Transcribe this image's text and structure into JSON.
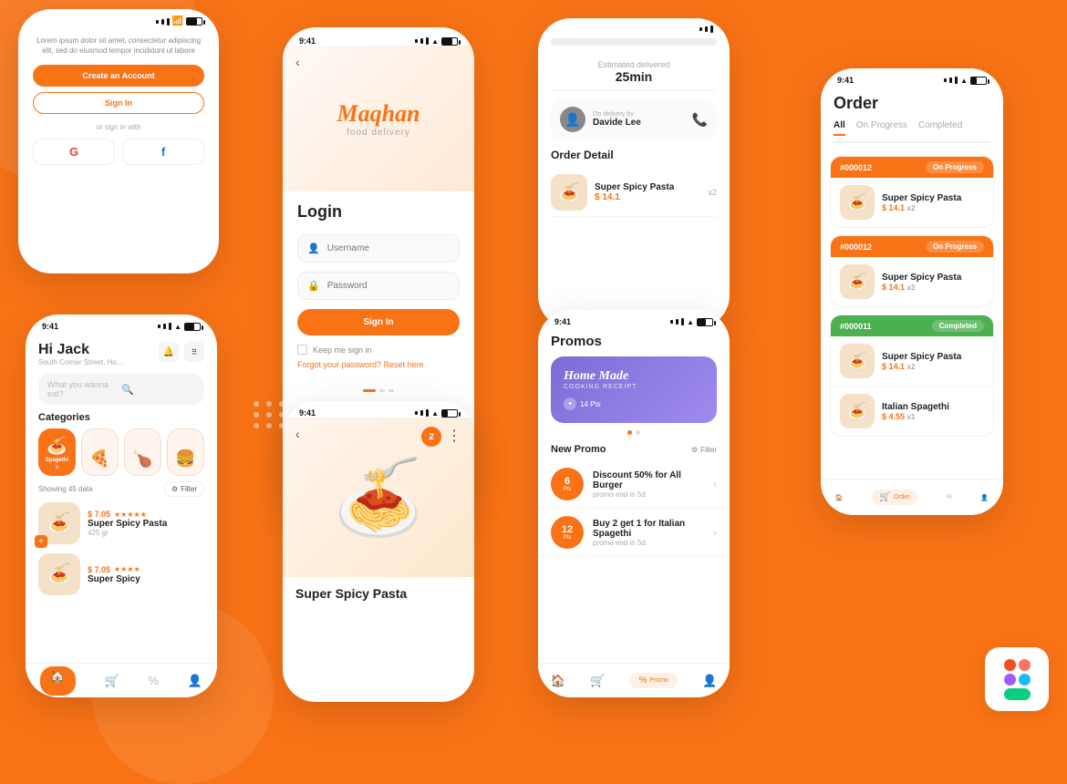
{
  "colors": {
    "primary": "#F97316",
    "white": "#ffffff",
    "dark": "#222222",
    "gray": "#888888",
    "light_gray": "#f5f5f5",
    "green": "#4CAF50"
  },
  "phone_signin": {
    "tagline": "Lorem ipsum dolor sit amet, consectetur adipiscing elit, sed do eiusmod tempor incididunt ut labore",
    "create_btn": "Create an Account",
    "signin_btn": "Sign In",
    "or_text": "or sign in with"
  },
  "phone_login": {
    "app_name": "Maqhan",
    "app_sub": "food delivery",
    "title": "Login",
    "username_placeholder": "Username",
    "password_placeholder": "Password",
    "signin_btn": "Sign In",
    "keep_label": "Keep me sign in",
    "forgot_text": "Forgot your password?",
    "reset_text": "Reset here"
  },
  "phone_home": {
    "greeting": "Hi Jack",
    "address": "South Corner Street, Ho...",
    "search_placeholder": "What you wanna eat?",
    "categories_title": "Categories",
    "categories": [
      {
        "label": "Spagethi",
        "icon": "🍝",
        "active": true
      },
      {
        "label": "Pizza",
        "icon": "🍕",
        "active": false
      },
      {
        "label": "Chicken",
        "icon": "🍗",
        "active": false
      },
      {
        "label": "Burger",
        "icon": "🍔",
        "active": false
      }
    ],
    "showing": "Showing 45 data",
    "filter_label": "Filter",
    "foods": [
      {
        "name": "Super Spicy Pasta",
        "weight": "425 gr",
        "price": "$ 7.05",
        "stars": "★★★★★"
      },
      {
        "name": "Super Spicy",
        "weight": "",
        "price": "$ 7.05",
        "stars": "★★★★"
      }
    ],
    "nav": [
      "Home",
      "Cart",
      "Promo",
      "Profile"
    ]
  },
  "phone_order_detail": {
    "estimated_label": "Estimated delivered",
    "estimated_time": "25min",
    "delivery_label": "On delivery by",
    "driver": "Davide Lee",
    "order_detail_title": "Order Detail",
    "item_name": "Super Spicy Pasta",
    "item_price": "$ 14.1",
    "item_qty": "x2"
  },
  "phone_food_detail": {
    "name": "Super Spicy Pasta",
    "badge": "2"
  },
  "phone_promos": {
    "title": "Promos",
    "banner": {
      "title": "Home Made",
      "sub": "COOKING RECEIPT",
      "pts": "14 Pts"
    },
    "new_promo_title": "New Promo",
    "filter_label": "Filter",
    "items": [
      {
        "pts": "6",
        "name": "Discount 50% for All Burger",
        "end": "promo end in 5d"
      },
      {
        "pts": "12",
        "name": "Buy 2 get 1 for Italian Spagethi",
        "end": "promo end in 5d"
      }
    ],
    "nav": [
      "Home",
      "Cart",
      "Promo",
      "Profile"
    ]
  },
  "phone_order_list": {
    "title": "Order",
    "tabs": [
      "All",
      "On Progress",
      "Completed"
    ],
    "active_tab": "All",
    "orders": [
      {
        "id": "#000012",
        "status": "On Progress",
        "status_type": "in-progress",
        "items": [
          {
            "name": "Super Spicy Pasta",
            "price": "$ 14.1",
            "qty": "x2"
          }
        ]
      },
      {
        "id": "#000012",
        "status": "On Progress",
        "status_type": "in-progress",
        "items": [
          {
            "name": "Super Spicy Pasta",
            "price": "$ 14.1",
            "qty": "x2"
          }
        ]
      },
      {
        "id": "#000011",
        "status": "Completed",
        "status_type": "completed",
        "items": [
          {
            "name": "Super Spicy Pasta",
            "price": "$ 14.1",
            "qty": "x2"
          },
          {
            "name": "Italian Spagethi",
            "price": "$ 4.55",
            "qty": "x1"
          }
        ]
      }
    ],
    "nav": [
      "Home",
      "Order",
      "Promo",
      "Profile"
    ]
  },
  "figma_logo": {
    "colors": [
      "#F24E1E",
      "#FF7262",
      "#A259FF",
      "#1ABCFE",
      "#0ACF83"
    ]
  }
}
